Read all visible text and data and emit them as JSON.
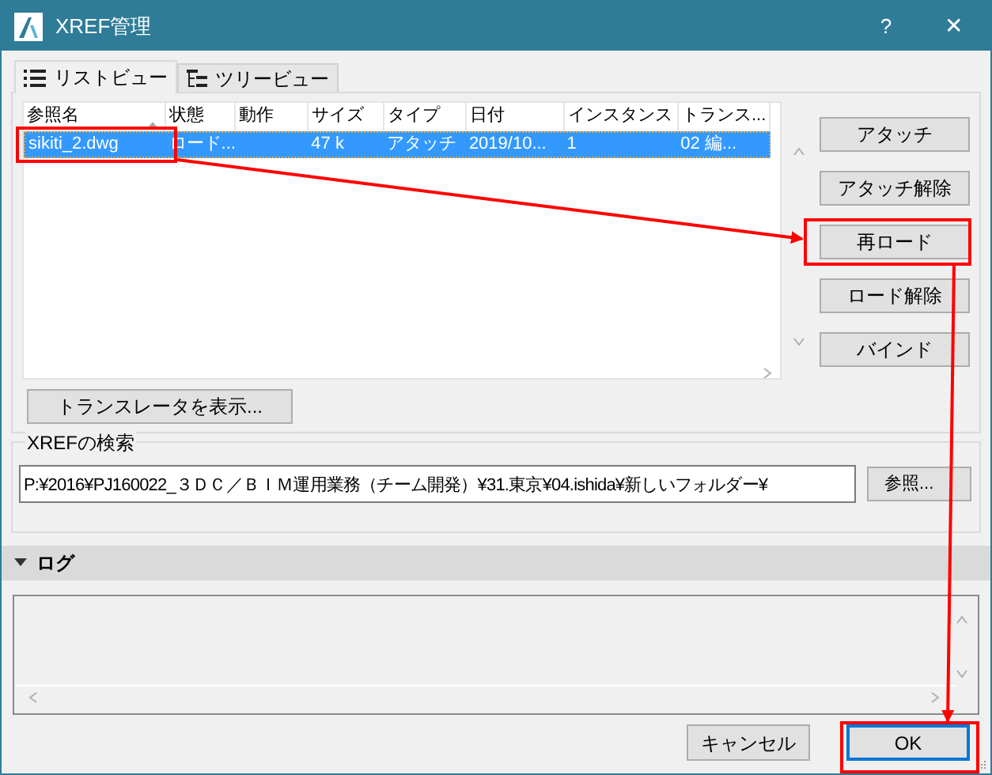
{
  "window": {
    "title": "XREF管理",
    "help": "?",
    "close": "✕"
  },
  "tabs": [
    {
      "label": "リストビュー",
      "selected": true
    },
    {
      "label": "ツリービュー",
      "selected": false
    }
  ],
  "table": {
    "columns": [
      "参照名",
      "状態",
      "動作",
      "サイズ",
      "タイプ",
      "日付",
      "インスタンス",
      "トランス..."
    ],
    "rows": [
      {
        "selected": true,
        "cells": [
          "sikiti_2.dwg",
          "ロード...",
          "",
          "47 k",
          "アタッチ",
          "2019/10...",
          "1",
          "02 編..."
        ]
      }
    ]
  },
  "side_buttons": [
    "アタッチ",
    "アタッチ解除",
    "再ロード",
    "ロード解除",
    "バインド"
  ],
  "translator_button": "トランスレータを表示...",
  "search": {
    "label": "XREFの検索",
    "value": "P:¥2016¥PJ160022_３ＤＣ／ＢＩＭ運用業務（チーム開発）¥31.東京¥04.ishida¥新しいフォルダー¥",
    "browse": "参照..."
  },
  "log": {
    "label": "ログ",
    "expanded": true
  },
  "buttons": [
    {
      "label": "キャンセル",
      "default": false
    },
    {
      "label": "OK",
      "default": true
    }
  ]
}
